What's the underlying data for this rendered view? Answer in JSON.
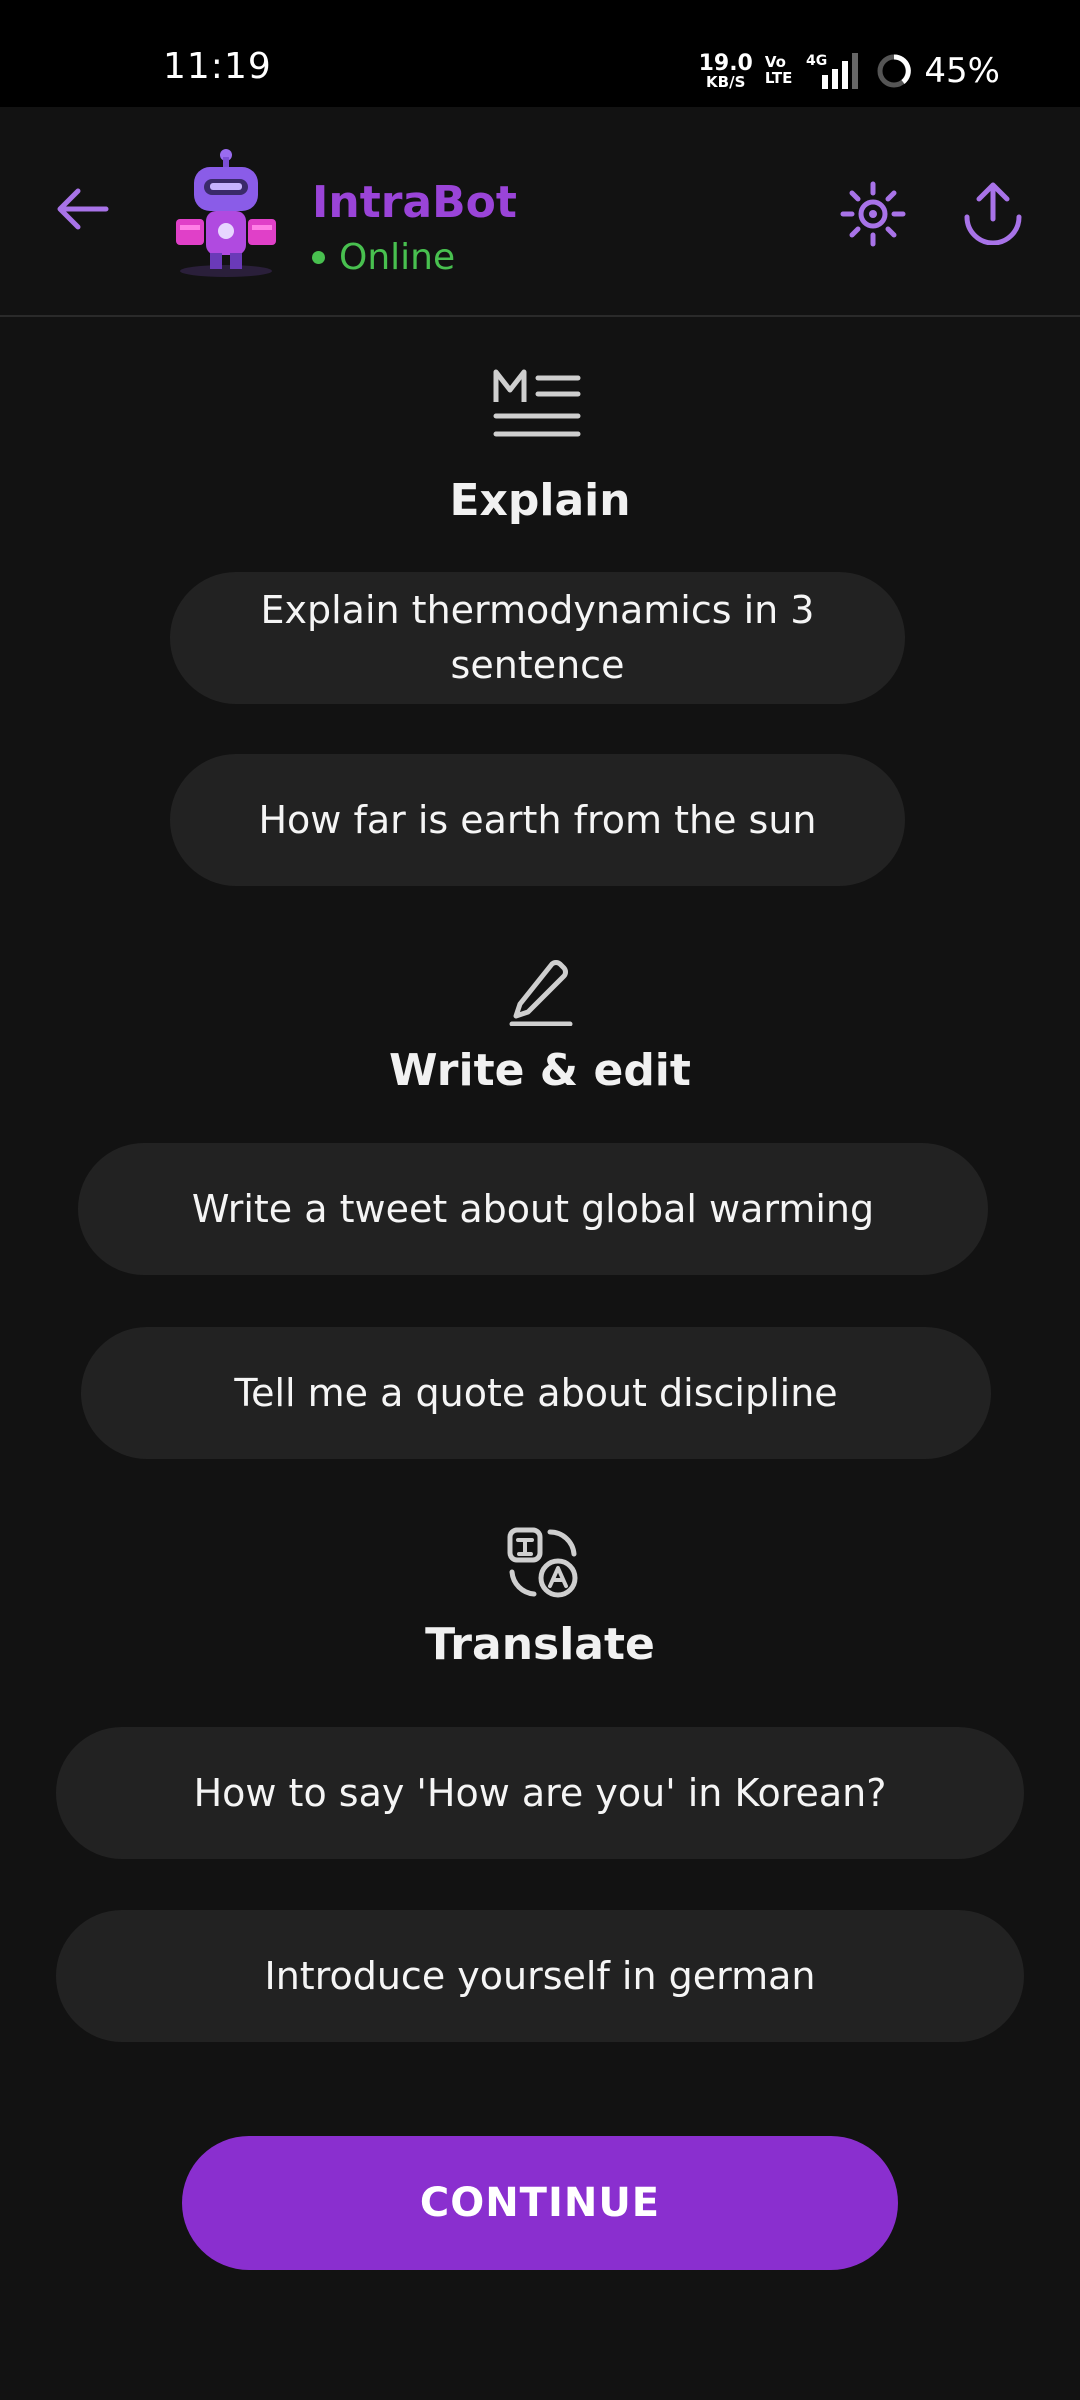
{
  "status_bar": {
    "time": "11:19",
    "net_speed_value": "19.0",
    "net_speed_unit": "KB/S",
    "volte_top": "Vo",
    "volte_bottom": "LTE",
    "network": "4G",
    "battery": "45%"
  },
  "header": {
    "bot_name": "IntraBot",
    "status": "Online",
    "accent_color": "#9a44d8",
    "status_color": "#48c04f",
    "icons": [
      "back-arrow-icon",
      "sun-icon",
      "share-upload-icon"
    ]
  },
  "sections": [
    {
      "title": "Explain",
      "icon": "markdown-text-icon",
      "prompts": [
        "Explain thermodynamics in 3 sentence",
        "How far is earth from the sun"
      ]
    },
    {
      "title": "Write & edit",
      "icon": "pencil-icon",
      "prompts": [
        "Write a tweet about global warming",
        "Tell me a quote about discipline"
      ]
    },
    {
      "title": "Translate",
      "icon": "translate-icon",
      "prompts": [
        "How to say 'How are you' in Korean?",
        "Introduce yourself in german"
      ]
    }
  ],
  "continue_button": {
    "label": "CONTINUE",
    "color": "#8a2fcf"
  }
}
